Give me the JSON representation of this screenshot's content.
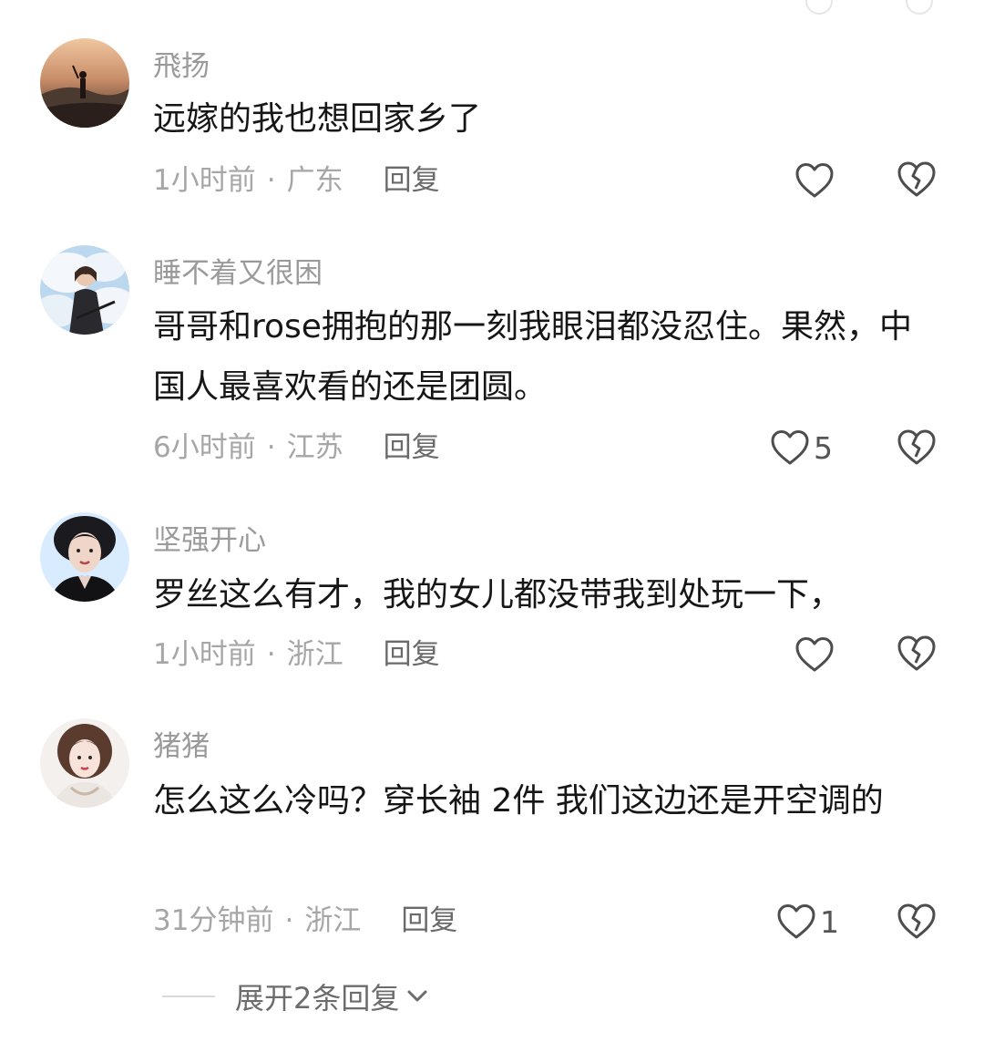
{
  "comments": [
    {
      "username": "飛扬",
      "text": "远嫁的我也想回家乡了",
      "time": "1小时前",
      "location": "广东",
      "reply_label": "回复",
      "likes": ""
    },
    {
      "username": "睡不着又很困",
      "text": "哥哥和rose拥抱的那一刻我眼泪都没忍住。果然，中国人最喜欢看的还是团圆。",
      "time": "6小时前",
      "location": "江苏",
      "reply_label": "回复",
      "likes": "5"
    },
    {
      "username": "坚强开心",
      "text": "罗丝这么有才，我的女儿都没带我到处玩一下，",
      "time": "1小时前",
      "location": "浙江",
      "reply_label": "回复",
      "likes": ""
    },
    {
      "username": "猪猪",
      "text": "怎么这么冷吗？穿长袖 2件 我们这边还是开空调的",
      "time": "31分钟前",
      "location": "浙江",
      "reply_label": "回复",
      "likes": "1"
    }
  ],
  "meta_separator": "·",
  "expand_replies": {
    "label": "展开2条回复",
    "icon": "chevron-down-icon"
  },
  "icons": {
    "like": "heart-outline-icon",
    "dislike": "broken-heart-icon"
  },
  "colors": {
    "username": "#9a9a9a",
    "text": "#161616",
    "meta": "#a6a6a6",
    "icon_stroke": "#4d4d4d"
  }
}
